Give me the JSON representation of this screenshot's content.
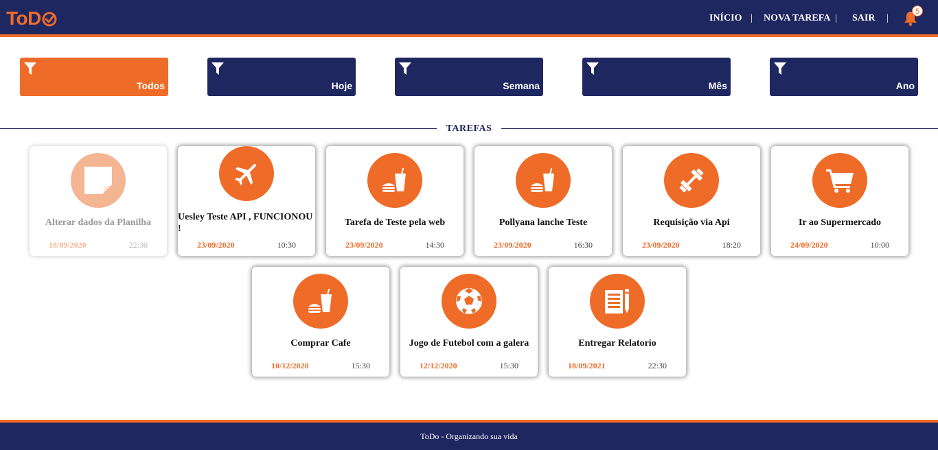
{
  "header": {
    "logo_text": "ToD",
    "nav": {
      "inicio": "INÍCIO",
      "nova_tarefa": "NOVA TAREFA",
      "sair": "SAIR",
      "separator": "|"
    },
    "notifications_count": "5"
  },
  "filters": [
    {
      "label": "Todos",
      "active": true
    },
    {
      "label": "Hoje",
      "active": false
    },
    {
      "label": "Semana",
      "active": false
    },
    {
      "label": "Mês",
      "active": false
    },
    {
      "label": "Ano",
      "active": false
    }
  ],
  "section_title": "TAREFAS",
  "tasks": [
    {
      "title": "Alterar dados da Planilha",
      "date": "18/09/2020",
      "time": "22:30",
      "icon": "sticky-note-icon",
      "faded": true
    },
    {
      "title": "Uesley Teste API , FUNCIONOU !",
      "date": "23/09/2020",
      "time": "10:30",
      "icon": "plane-icon"
    },
    {
      "title": "Tarefa de Teste pela web",
      "date": "23/09/2020",
      "time": "14:30",
      "icon": "food-drink-icon"
    },
    {
      "title": "Pollyana lanche Teste",
      "date": "23/09/2020",
      "time": "16:30",
      "icon": "food-drink-icon"
    },
    {
      "title": "Requisição via Api",
      "date": "23/09/2020",
      "time": "18:20",
      "icon": "dumbbell-icon"
    },
    {
      "title": "Ir ao Supermercado",
      "date": "24/09/2020",
      "time": "10:00",
      "icon": "shopping-cart-icon"
    },
    {
      "title": "Comprar Cafe",
      "date": "10/12/2020",
      "time": "15:30",
      "icon": "food-drink-icon"
    },
    {
      "title": "Jogo de Futebol com a galera",
      "date": "12/12/2020",
      "time": "15:30",
      "icon": "soccer-ball-icon"
    },
    {
      "title": "Entregar Relatorio",
      "date": "18/09/2021",
      "time": "22:30",
      "icon": "report-icon"
    }
  ],
  "footer": {
    "text": "ToDo - Organizando sua vida"
  },
  "colors": {
    "navy": "#1f2761",
    "orange": "#ee6b28",
    "faded_orange": "#f4b593"
  }
}
